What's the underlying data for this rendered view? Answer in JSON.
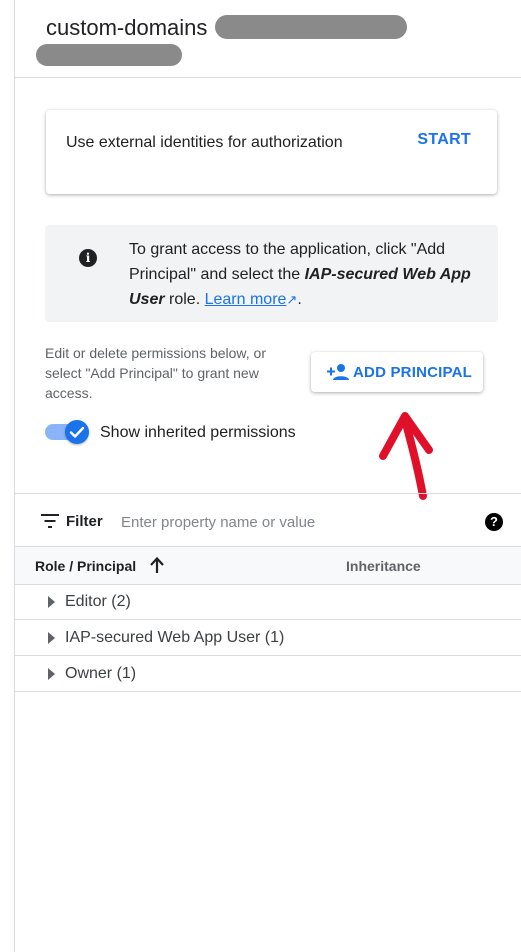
{
  "header": {
    "title": "custom-domains"
  },
  "external_card": {
    "text": "Use external identities for authorization",
    "action": "START"
  },
  "info": {
    "icon": "info-icon",
    "text_before": "To grant access to the application, click \"Add Principal\" and select the ",
    "role_name": "IAP-secured Web App User",
    "text_after": " role. ",
    "link": "Learn more",
    "period": "."
  },
  "description": "Edit or delete permissions below, or select \"Add Principal\" to grant new access.",
  "add_principal": {
    "label": "ADD PRINCIPAL",
    "icon": "person-add-icon"
  },
  "toggle": {
    "label": "Show inherited permissions",
    "checked": true
  },
  "filter": {
    "label": "Filter",
    "placeholder": "Enter property name or value"
  },
  "table": {
    "columns": [
      "Role / Principal",
      "Inheritance"
    ],
    "rows": [
      {
        "label": "Editor (2)"
      },
      {
        "label": "IAP-secured Web App User (1)"
      },
      {
        "label": "Owner (1)"
      }
    ]
  },
  "colors": {
    "accent": "#1a73e8",
    "annotation_arrow": "#e0102a"
  }
}
